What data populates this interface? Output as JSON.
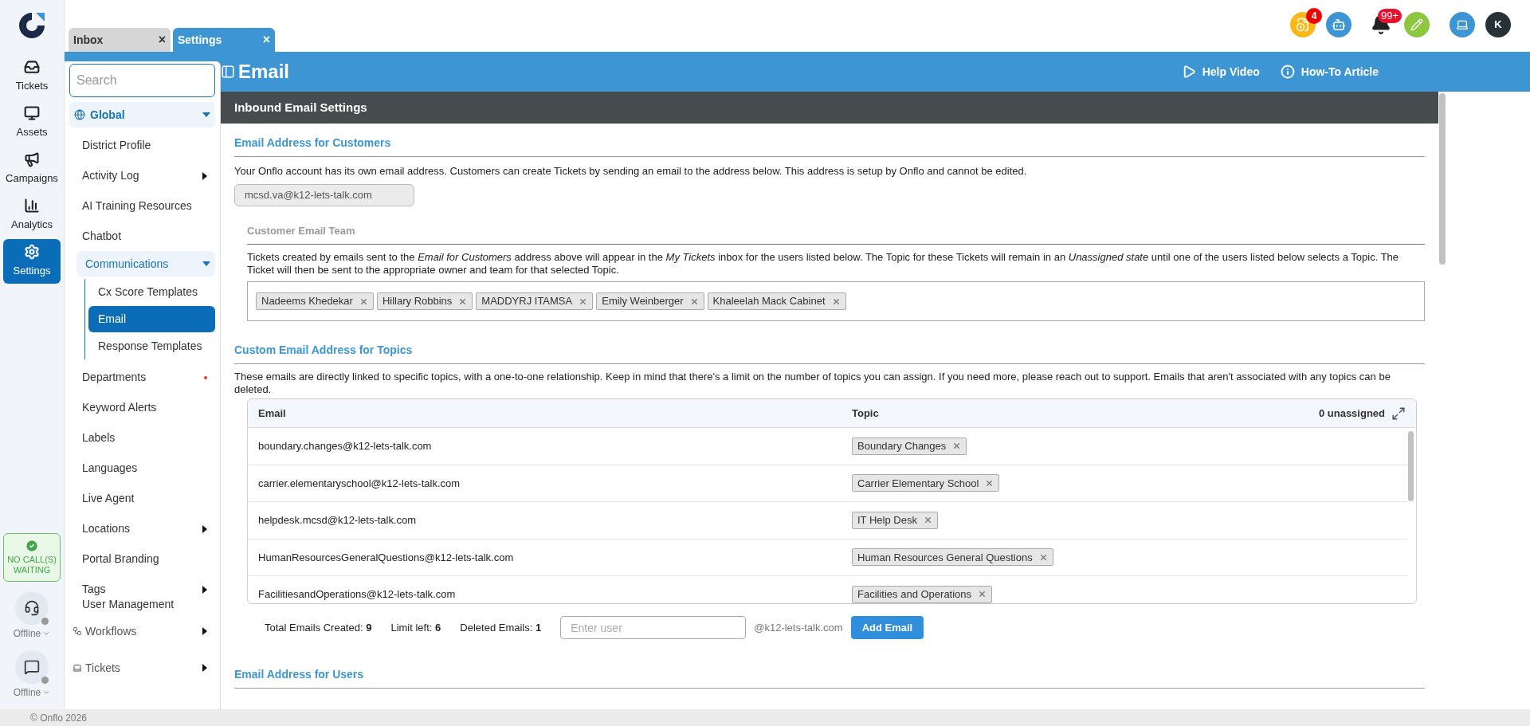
{
  "rail": {
    "items": [
      {
        "label": "Tickets",
        "selected": false
      },
      {
        "label": "Assets",
        "selected": false
      },
      {
        "label": "Campaigns",
        "selected": false
      },
      {
        "label": "Analytics",
        "selected": false
      },
      {
        "label": "Settings",
        "selected": true
      }
    ],
    "call_status": "NO CALL(S) WAITING",
    "presence": [
      {
        "label": "Offline"
      },
      {
        "label": "Offline"
      }
    ]
  },
  "tabs": [
    {
      "label": "Inbox",
      "selected": false,
      "close": "×"
    },
    {
      "label": "Settings",
      "selected": true,
      "close": "×"
    }
  ],
  "top_icons": {
    "tasks_badge": "4",
    "bell_badge": "99+",
    "avatar": "K"
  },
  "sidebar": {
    "search_placeholder": "Search",
    "sections": [
      {
        "label": "Global",
        "expanded": true,
        "items": [
          {
            "label": "District Profile",
            "submenu": false,
            "alert": false
          },
          {
            "label": "Activity Log",
            "submenu": true,
            "alert": false
          },
          {
            "label": "AI Training Resources",
            "submenu": false,
            "alert": false
          },
          {
            "label": "Chatbot",
            "submenu": false,
            "alert": false
          },
          {
            "label": "Communications",
            "expanded": true,
            "children": [
              {
                "label": "Cx Score Templates",
                "selected": false
              },
              {
                "label": "Email",
                "selected": true
              },
              {
                "label": "Response Templates",
                "selected": false
              }
            ]
          },
          {
            "label": "Departments",
            "submenu": false,
            "alert": true
          },
          {
            "label": "Keyword Alerts",
            "submenu": false,
            "alert": false
          },
          {
            "label": "Labels",
            "submenu": false,
            "alert": false
          },
          {
            "label": "Languages",
            "submenu": false,
            "alert": false
          },
          {
            "label": "Live Agent",
            "submenu": false,
            "alert": false
          },
          {
            "label": "Locations",
            "submenu": true,
            "alert": false
          },
          {
            "label": "Portal Branding",
            "submenu": false,
            "alert": false
          },
          {
            "label": "Tags",
            "submenu": true,
            "alert": false
          },
          {
            "label": "User Management",
            "submenu": false,
            "alert": false
          }
        ]
      },
      {
        "label": "Workflows",
        "expanded": false
      },
      {
        "label": "Tickets",
        "expanded": false
      }
    ]
  },
  "page": {
    "title": "Email",
    "links": [
      "Help Video",
      "How-To Article"
    ]
  },
  "panel": {
    "title": "Inbound Email Settings",
    "customers": {
      "heading": "Email Address for Customers",
      "text": "Your Onflo account has its own email address. Customers can create Tickets by sending an email to the address below. This address is setup by Onflo and cannot be edited.",
      "address": "mcsd.va@k12-lets-talk.com",
      "team": {
        "heading": "Customer Email Team",
        "text": "Tickets created by emails sent to the *Email for Customers* address above will appear in the *My Tickets* inbox for the users listed below. The Topic for these Tickets will remain in an *Unassigned state* until one of the users listed below selects a Topic. The Ticket will then be sent to the appropriate owner and team for that selected Topic.",
        "members": [
          "Nadeems Khedekar",
          "Hillary Robbins",
          "MADDYRJ ITAMSA",
          "Emily Weinberger",
          "Khaleelah Mack Cabinet"
        ]
      }
    },
    "topics": {
      "heading": "Custom Email Address for Topics",
      "text": "These emails are directly linked to specific topics, with a one-to-one relationship. Keep in mind that there's a limit on the number of topics you can assign. If you need more, please reach out to support. Emails that aren't associated with any topics can be deleted.",
      "table": {
        "columns": [
          "Email",
          "Topic"
        ],
        "unassigned": "0 unassigned",
        "rows": [
          {
            "email": "boundary.changes@k12-lets-talk.com",
            "topic": "Boundary Changes"
          },
          {
            "email": "carrier.elementaryschool@k12-lets-talk.com",
            "topic": "Carrier Elementary School"
          },
          {
            "email": "helpdesk.mcsd@k12-lets-talk.com",
            "topic": "IT Help Desk"
          },
          {
            "email": "HumanResourcesGeneralQuestions@k12-lets-talk.com",
            "topic": "Human Resources General Questions"
          },
          {
            "email": "FacilitiesandOperations@k12-lets-talk.com",
            "topic": "Facilities and Operations"
          }
        ]
      },
      "stats": [
        {
          "label": "Total Emails Created:",
          "value": "9"
        },
        {
          "label": "Limit left:",
          "value": "6"
        },
        {
          "label": "Deleted Emails:",
          "value": "1"
        }
      ],
      "input_placeholder": "Enter user",
      "domain": "@k12-lets-talk.com",
      "add_button": "Add Email"
    },
    "users": {
      "heading": "Email Address for Users"
    }
  },
  "footer": "© Onflo 2026"
}
